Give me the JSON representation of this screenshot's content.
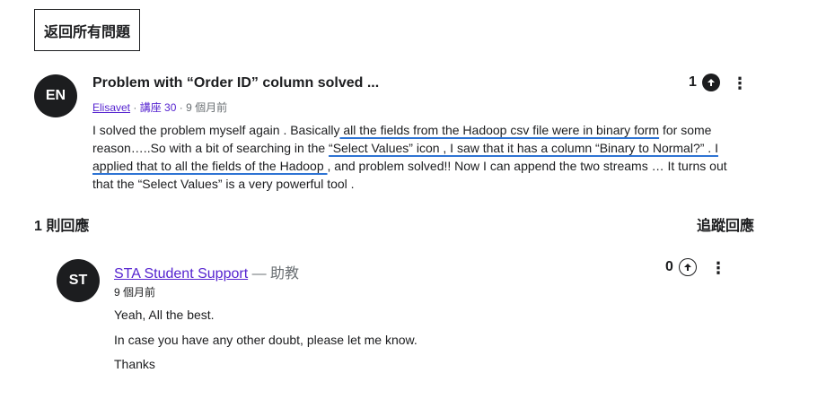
{
  "back_button": {
    "label": "返回所有問題"
  },
  "question": {
    "avatar_initials": "EN",
    "title": "Problem with “Order ID” column solved ...",
    "author": "Elisavet",
    "separator": " · ",
    "lecture": "講座 30",
    "time": "9 個月前",
    "votes": "1",
    "body": {
      "p1": "I solved the problem myself again . Basically",
      "h1": " all the fields from the Hadoop csv file were in binary form",
      "p2": " for some reason…..So with a bit of searching in the ",
      "h2": "“Select Values” icon , I saw that it has a column “Binary to Normal?” . I applied that to all the fields of the Hadoop ",
      "p3": ", and problem solved!! Now I can append the two streams … It turns out that the “Select Values” is a very powerful tool ."
    }
  },
  "replies": {
    "count_label": "1 則回應",
    "follow_label": "追蹤回應"
  },
  "answer": {
    "avatar_initials": "ST",
    "author": "STA Student Support",
    "role": " — 助教",
    "time": "9 個月前",
    "votes": "0",
    "lines": [
      "Yeah, All the best.",
      "In case you have any other doubt, please let me know.",
      "Thanks"
    ]
  },
  "colors": {
    "link": "#5624d0",
    "highlight_underline": "#2e74d4",
    "dark": "#1c1d1f"
  },
  "icons": {
    "upvote": "arrow-up-icon",
    "more": "kebab-menu-icon"
  }
}
